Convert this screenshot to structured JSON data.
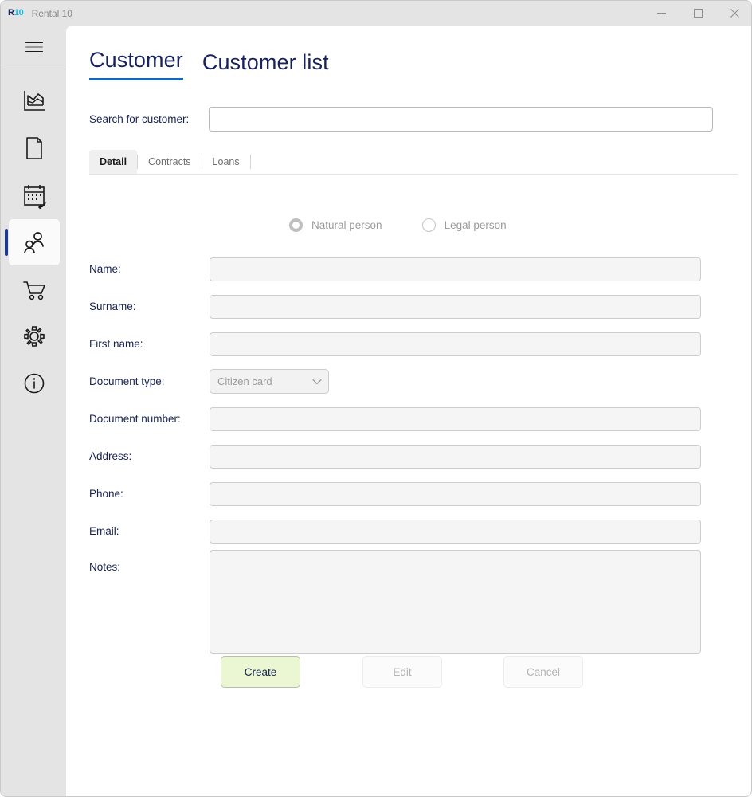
{
  "window": {
    "logo_primary": "R",
    "logo_secondary": "10",
    "title": "Rental 10",
    "controls": {
      "minimize": "minimize-icon",
      "maximize": "maximize-icon",
      "close": "close-icon"
    }
  },
  "sidebar": {
    "menu_button": "hamburger-menu-icon",
    "items": [
      {
        "icon": "chart-area-icon",
        "name": "analytics",
        "selected": false
      },
      {
        "icon": "document-icon",
        "name": "documents",
        "selected": false
      },
      {
        "icon": "calendar-return-icon",
        "name": "returns",
        "selected": false
      },
      {
        "icon": "people-icon",
        "name": "customers",
        "selected": true
      },
      {
        "icon": "shopping-cart-icon",
        "name": "orders",
        "selected": false
      },
      {
        "icon": "gear-icon",
        "name": "settings",
        "selected": false
      },
      {
        "icon": "info-circle-icon",
        "name": "about",
        "selected": false
      }
    ]
  },
  "page_tabs": [
    {
      "label": "Customer",
      "active": true
    },
    {
      "label": "Customer list",
      "active": false
    }
  ],
  "search": {
    "label": "Search for customer:",
    "value": "",
    "placeholder": ""
  },
  "subtabs": [
    {
      "label": "Detail",
      "active": true
    },
    {
      "label": "Contracts",
      "active": false
    },
    {
      "label": "Loans",
      "active": false
    }
  ],
  "person_type": {
    "options": [
      {
        "label": "Natural person",
        "checked": true,
        "disabled": true
      },
      {
        "label": "Legal person",
        "checked": false,
        "disabled": true
      }
    ]
  },
  "form": {
    "fields": [
      {
        "label": "Name:",
        "value": "",
        "type": "text",
        "disabled": true
      },
      {
        "label": "Surname:",
        "value": "",
        "type": "text",
        "disabled": true
      },
      {
        "label": "First name:",
        "value": "",
        "type": "text",
        "disabled": true
      },
      {
        "label": "Document type:",
        "value": "Citizen card",
        "type": "select",
        "disabled": true
      },
      {
        "label": "Document number:",
        "value": "",
        "type": "text",
        "disabled": true
      },
      {
        "label": "Address:",
        "value": "",
        "type": "text",
        "disabled": true
      },
      {
        "label": "Phone:",
        "value": "",
        "type": "text",
        "disabled": true
      },
      {
        "label": "Email:",
        "value": "",
        "type": "text",
        "disabled": true
      },
      {
        "label": "Notes:",
        "value": "",
        "type": "textarea",
        "disabled": true
      }
    ],
    "document_type_options": [
      "Citizen card"
    ]
  },
  "actions": {
    "create_label": "Create",
    "edit_label": "Edit",
    "cancel_label": "Cancel"
  },
  "colors": {
    "accent_blue": "#1565c0",
    "navy_text": "#16214f",
    "selected_indicator": "#1a3a8f",
    "create_green": "#eaf7d2",
    "logo_cyan": "#16b7e0",
    "chrome_gray": "#e4e4e4"
  }
}
